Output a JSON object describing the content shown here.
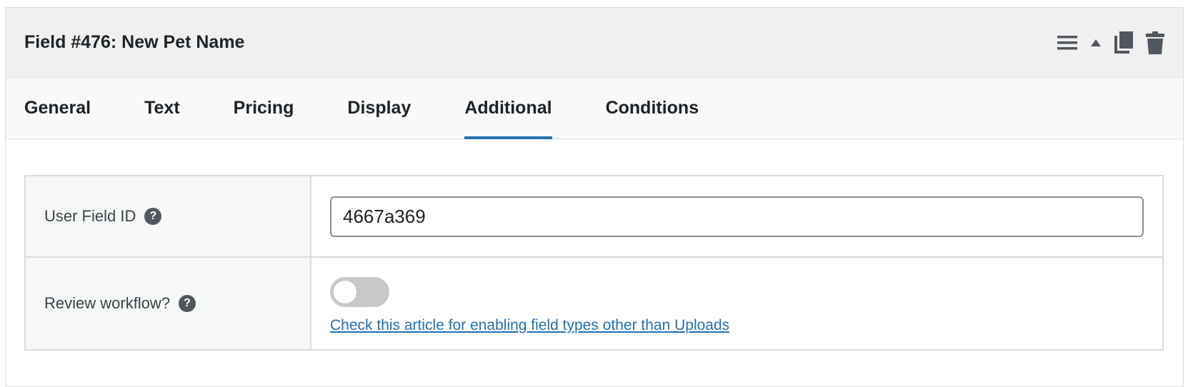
{
  "header": {
    "title": "Field #476: New Pet Name",
    "actions": [
      {
        "name": "menu-icon"
      },
      {
        "name": "collapse-arrow-icon"
      },
      {
        "name": "duplicate-icon"
      },
      {
        "name": "trash-icon"
      }
    ]
  },
  "tabs": [
    {
      "label": "General",
      "active": false
    },
    {
      "label": "Text",
      "active": false
    },
    {
      "label": "Pricing",
      "active": false
    },
    {
      "label": "Display",
      "active": false
    },
    {
      "label": "Additional",
      "active": true
    },
    {
      "label": "Conditions",
      "active": false
    }
  ],
  "settings": {
    "user_field_id": {
      "label": "User Field ID",
      "value": "4667a369",
      "help_icon": "question-icon"
    },
    "review_workflow": {
      "label": "Review workflow?",
      "enabled": false,
      "help_icon": "question-icon",
      "link_text": "Check this article for enabling field types other than Uploads"
    }
  },
  "colors": {
    "accent": "#2271b1",
    "header_bg": "#f0f0f1",
    "toggle_off": "#c8c8ca"
  }
}
